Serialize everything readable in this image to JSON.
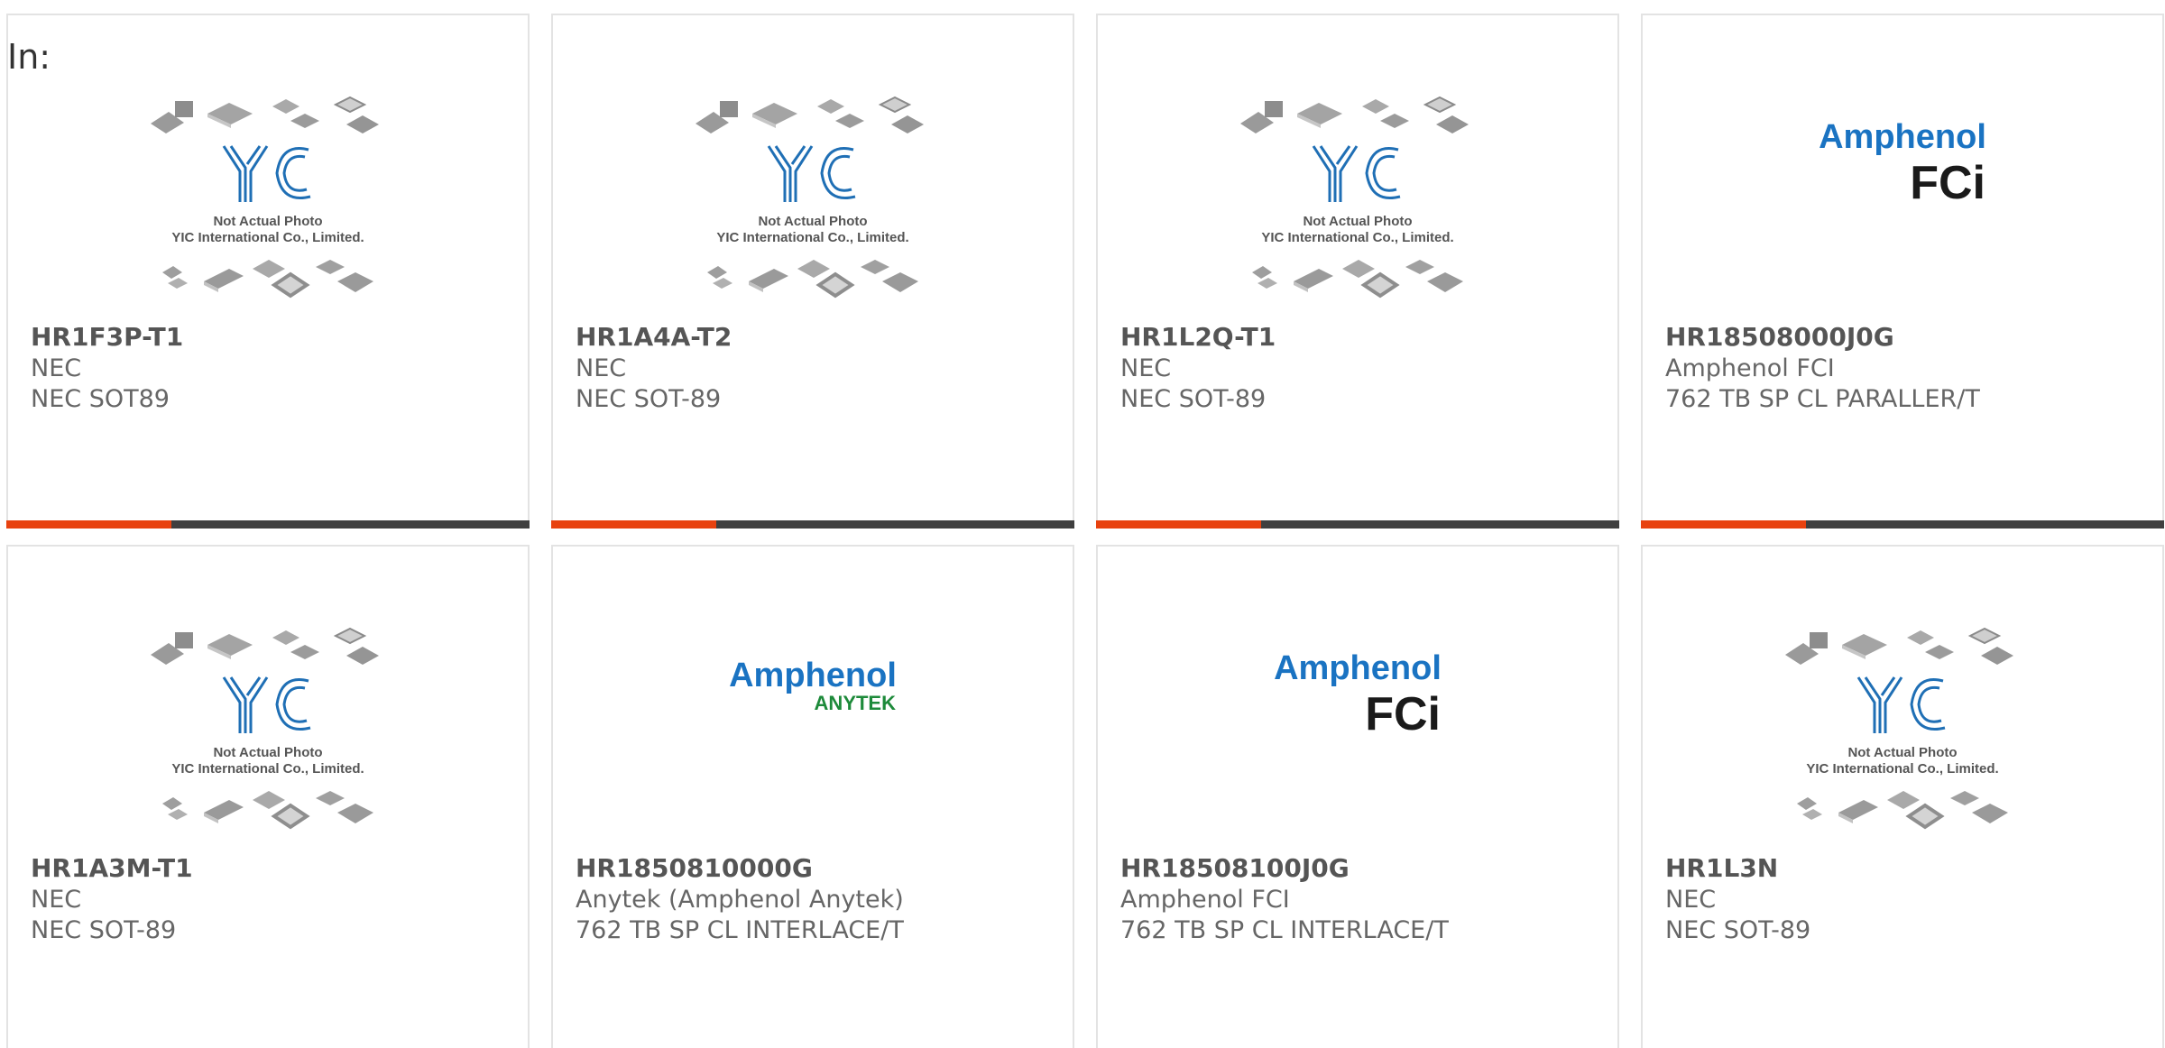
{
  "grid_label": "In:",
  "placeholder_image": {
    "caption_line1": "Not Actual Photo",
    "caption_line2": "YIC International Co., Limited.",
    "logo_text": "YIC"
  },
  "logos": {
    "amphenol_fci": {
      "brand": "Amphenol",
      "sub": "FCi"
    },
    "amphenol_anytek": {
      "brand": "Amphenol",
      "sub": "ANYTEK"
    }
  },
  "products": [
    {
      "part": "HR1F3P-T1",
      "manufacturer": "NEC",
      "description": "NEC SOT89",
      "image": "yic-placeholder"
    },
    {
      "part": "HR1A4A-T2",
      "manufacturer": "NEC",
      "description": "NEC SOT-89",
      "image": "yic-placeholder"
    },
    {
      "part": "HR1L2Q-T1",
      "manufacturer": "NEC",
      "description": "NEC SOT-89",
      "image": "yic-placeholder"
    },
    {
      "part": "HR18508000J0G",
      "manufacturer": "Amphenol FCI",
      "description": "762 TB SP CL PARALLER/T",
      "image": "amphenol-fci-logo"
    },
    {
      "part": "HR1A3M-T1",
      "manufacturer": "NEC",
      "description": "NEC SOT-89",
      "image": "yic-placeholder"
    },
    {
      "part": "HR1850810000G",
      "manufacturer": "Anytek (Amphenol Anytek)",
      "description": "762 TB SP CL INTERLACE/T",
      "image": "amphenol-anytek-logo"
    },
    {
      "part": "HR18508100J0G",
      "manufacturer": "Amphenol FCI",
      "description": "762 TB SP CL INTERLACE/T",
      "image": "amphenol-fci-logo"
    },
    {
      "part": "HR1L3N",
      "manufacturer": "NEC",
      "description": "NEC SOT-89",
      "image": "yic-placeholder"
    }
  ],
  "colors": {
    "accent": "#e8420f",
    "bar": "#3f3f3f",
    "amphenol_blue": "#1a73c2",
    "anytek_green": "#1d8a3a",
    "yic_blue": "#1f6fb5"
  }
}
